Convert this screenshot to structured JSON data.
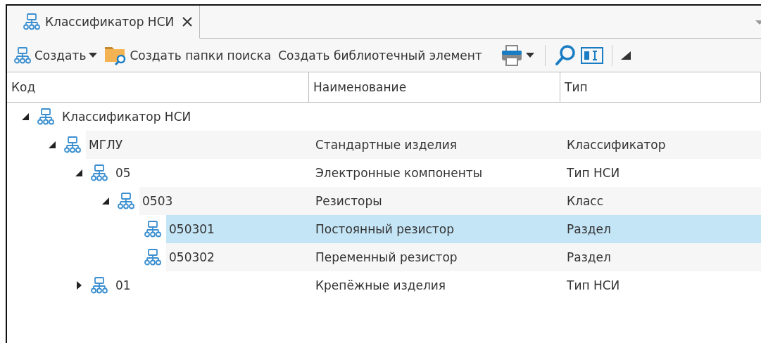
{
  "tabs": [
    {
      "label": "Классификатор НСИ",
      "selected": true
    }
  ],
  "toolbar": [
    {
      "kind": "menu",
      "label": "Создать"
    },
    {
      "kind": "folder",
      "label": "Создать папки поиска"
    },
    {
      "kind": "text",
      "label": "Создать библиотечный элемент"
    }
  ],
  "table": {
    "columns": [
      "Код",
      "Наименование",
      "Тип"
    ],
    "tree": [
      {
        "code": "Классификатор НСИ",
        "expanded": true,
        "selected": false,
        "children": [
          {
            "code": "МГЛУ",
            "name": "Стандартные изделия",
            "type": "Классификатор",
            "expanded": true,
            "selected": false,
            "children": [
              {
                "code": "05",
                "name": "Электронные компоненты",
                "type": "Тип НСИ",
                "expanded": true,
                "selected": false,
                "children": [
                  {
                    "code": "0503",
                    "name": "Резисторы",
                    "type": "Класс",
                    "expanded": true,
                    "selected": false,
                    "children": [
                      {
                        "code": "050301",
                        "name": "Постоянный резистор",
                        "type": "Раздел",
                        "selected": true
                      },
                      {
                        "code": "050302",
                        "name": "Переменный резистор",
                        "type": "Раздел",
                        "selected": false
                      }
                    ]
                  }
                ]
              },
              {
                "code": "01",
                "name": "Крепёжные изделия",
                "type": "Тип НСИ",
                "expanded": false,
                "selected": false
              }
            ]
          }
        ]
      }
    ]
  }
}
